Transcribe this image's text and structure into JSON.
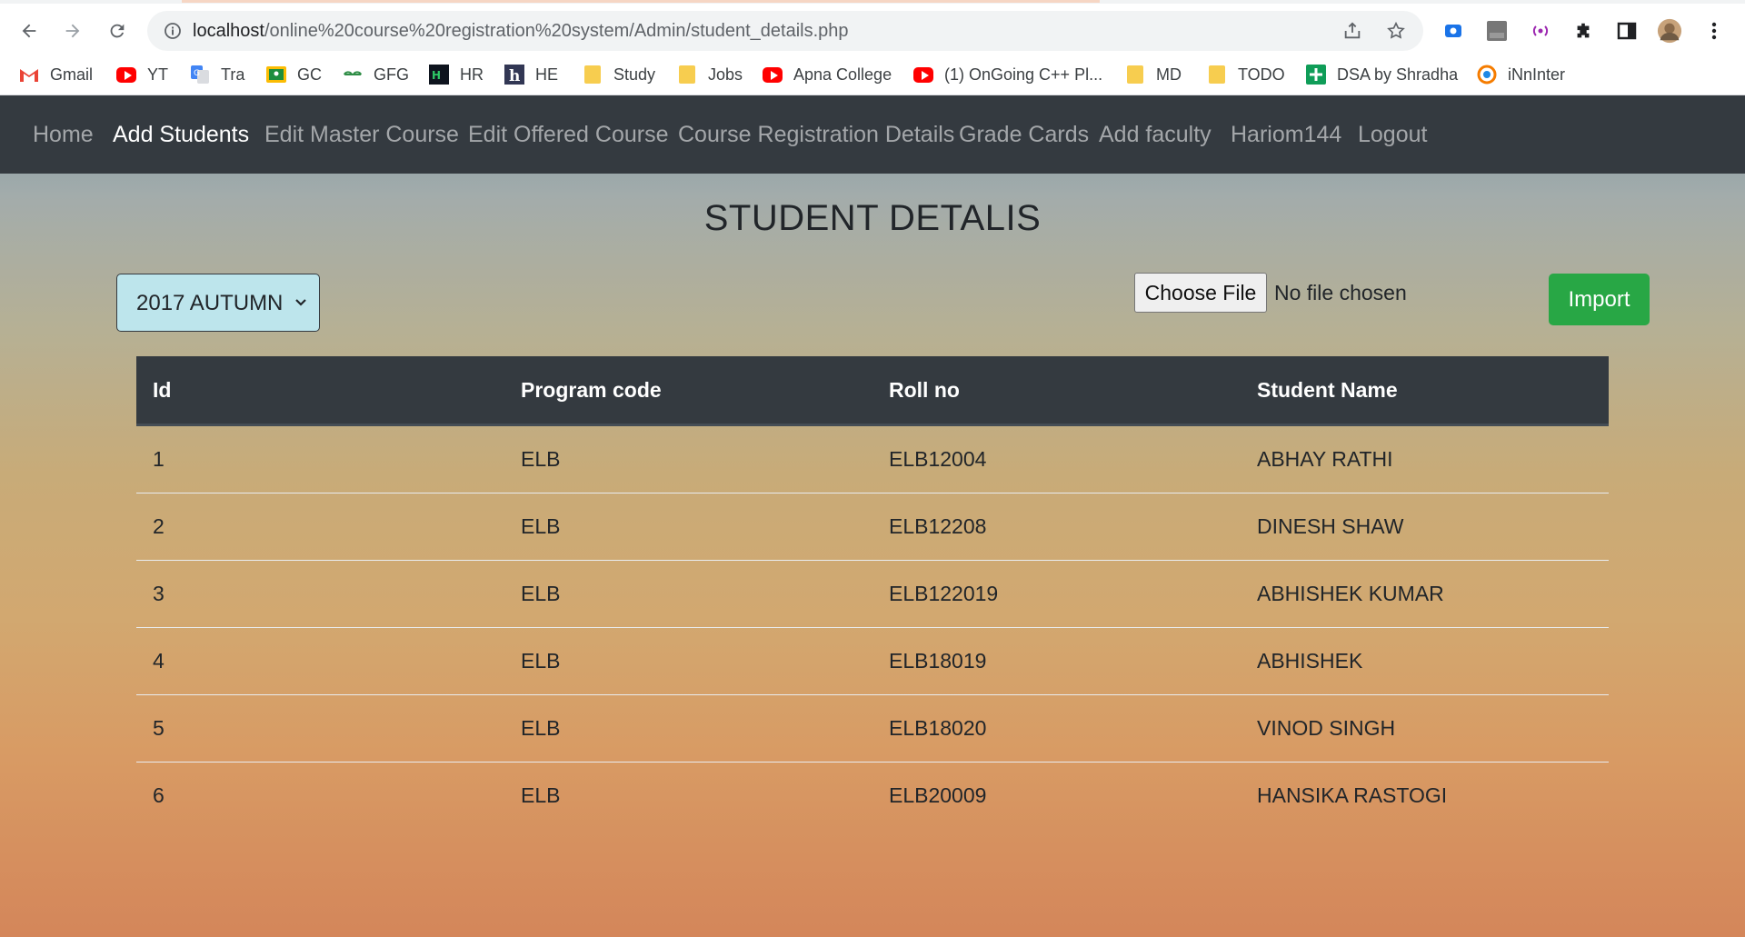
{
  "browser": {
    "url_host": "localhost",
    "url_path": "/online%20course%20registration%20system/Admin/student_details.php"
  },
  "bookmarks": [
    {
      "label": "Gmail",
      "icon": "gmail-icon"
    },
    {
      "label": "YT",
      "icon": "youtube-icon"
    },
    {
      "label": "Tra",
      "icon": "translate-icon"
    },
    {
      "label": "GC",
      "icon": "classroom-icon"
    },
    {
      "label": "GFG",
      "icon": "gfg-icon"
    },
    {
      "label": "HR",
      "icon": "hackerrank-icon"
    },
    {
      "label": "HE",
      "icon": "hackerearth-icon"
    },
    {
      "label": "Study",
      "icon": "folder-icon"
    },
    {
      "label": "Jobs",
      "icon": "folder-icon"
    },
    {
      "label": "Apna College",
      "icon": "youtube-icon"
    },
    {
      "label": "(1) OnGoing C++ Pl...",
      "icon": "youtube-icon"
    },
    {
      "label": "MD",
      "icon": "folder-icon"
    },
    {
      "label": "TODO",
      "icon": "folder-icon"
    },
    {
      "label": "DSA by Shradha",
      "icon": "sheets-icon"
    },
    {
      "label": "iNnInter",
      "icon": "innnter-icon"
    }
  ],
  "nav": {
    "items": [
      {
        "label": "Home"
      },
      {
        "label": "Add Students"
      },
      {
        "label": "Edit Master Course"
      },
      {
        "label": "Edit Offered Course"
      },
      {
        "label": "Course Registration Details"
      },
      {
        "label": "Grade Cards"
      },
      {
        "label": "Add faculty"
      },
      {
        "label": "Hariom144"
      },
      {
        "label": "Logout"
      }
    ],
    "active": "Add Students"
  },
  "page": {
    "title": "STUDENT DETALIS",
    "session_select": "2017 AUTUMN",
    "file_button": "Choose File",
    "file_status": "No file chosen",
    "import_button": "Import"
  },
  "table": {
    "headers": [
      "Id",
      "Program code",
      "Roll no",
      "Student Name"
    ],
    "rows": [
      [
        "1",
        "ELB",
        "ELB12004",
        "ABHAY RATHI"
      ],
      [
        "2",
        "ELB",
        "ELB12208",
        "DINESH SHAW"
      ],
      [
        "3",
        "ELB",
        "ELB122019",
        "ABHISHEK KUMAR"
      ],
      [
        "4",
        "ELB",
        "ELB18019",
        "ABHISHEK"
      ],
      [
        "5",
        "ELB",
        "ELB18020",
        "VINOD SINGH"
      ],
      [
        "6",
        "ELB",
        "ELB20009",
        "HANSIKA RASTOGI"
      ]
    ]
  },
  "colors": {
    "navbar": "#343a40",
    "import_button": "#28a745",
    "select_bg": "#bde5ec"
  }
}
